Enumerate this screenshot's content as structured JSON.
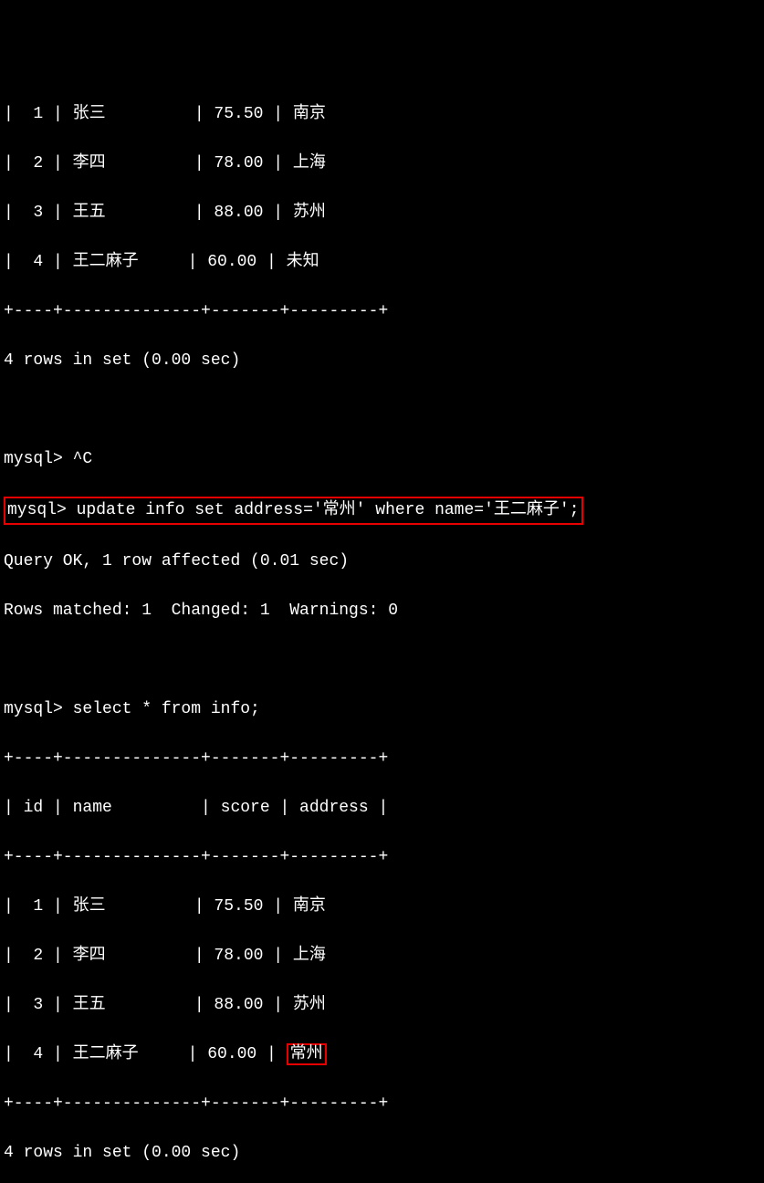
{
  "table1": {
    "rows": [
      {
        "id": "1",
        "name": "张三",
        "score": "75.50",
        "address": "南京"
      },
      {
        "id": "2",
        "name": "李四",
        "score": "78.00",
        "address": "上海"
      },
      {
        "id": "3",
        "name": "王五",
        "score": "88.00",
        "address": "苏州"
      },
      {
        "id": "4",
        "name": "王二麻子",
        "score": "60.00",
        "address": "未知"
      }
    ],
    "border": "+----+--------------+-------+---------+",
    "result": "4 rows in set (0.00 sec)"
  },
  "prompts": {
    "interrupt": "mysql> ^C",
    "update": "mysql> update info set address='常州' where name='王二麻子';",
    "update_prefix": "mysql> ",
    "update_cmd": "update info set address='常州' where name='王二麻子';",
    "query_ok": "Query OK, 1 row affected (0.01 sec)",
    "rows_matched": "Rows matched: 1  Changed: 1  Warnings: 0",
    "select": "mysql> select * from info;"
  },
  "table2": {
    "header_border": "+----+--------------+-------+---------+",
    "header_row": "| id | name         | score | address |",
    "rows": [
      {
        "id": "1",
        "name": "张三",
        "score": "75.50",
        "address": "南京"
      },
      {
        "id": "2",
        "name": "李四",
        "score": "78.00",
        "address": "上海"
      },
      {
        "id": "3",
        "name": "王五",
        "score": "88.00",
        "address": "苏州"
      },
      {
        "id": "4",
        "name": "王二麻子",
        "score": "60.00",
        "address": "常州"
      }
    ],
    "result": "4 rows in set (0.00 sec)"
  },
  "formatted": {
    "t1r1": "|  1 | 张三         | 75.50 | 南京",
    "t1r2": "|  2 | 李四         | 78.00 | 上海",
    "t1r3": "|  3 | 王五         | 88.00 | 苏州",
    "t1r4": "|  4 | 王二麻子     | 60.00 | 未知",
    "t2r1": "|  1 | 张三         | 75.50 | 南京",
    "t2r2": "|  2 | 李四         | 78.00 | 上海",
    "t2r3": "|  3 | 王五         | 88.00 | 苏州",
    "t2r4_prefix": "|  4 | 王二麻子     | 60.00 | ",
    "t2r4_highlighted": "常州"
  }
}
